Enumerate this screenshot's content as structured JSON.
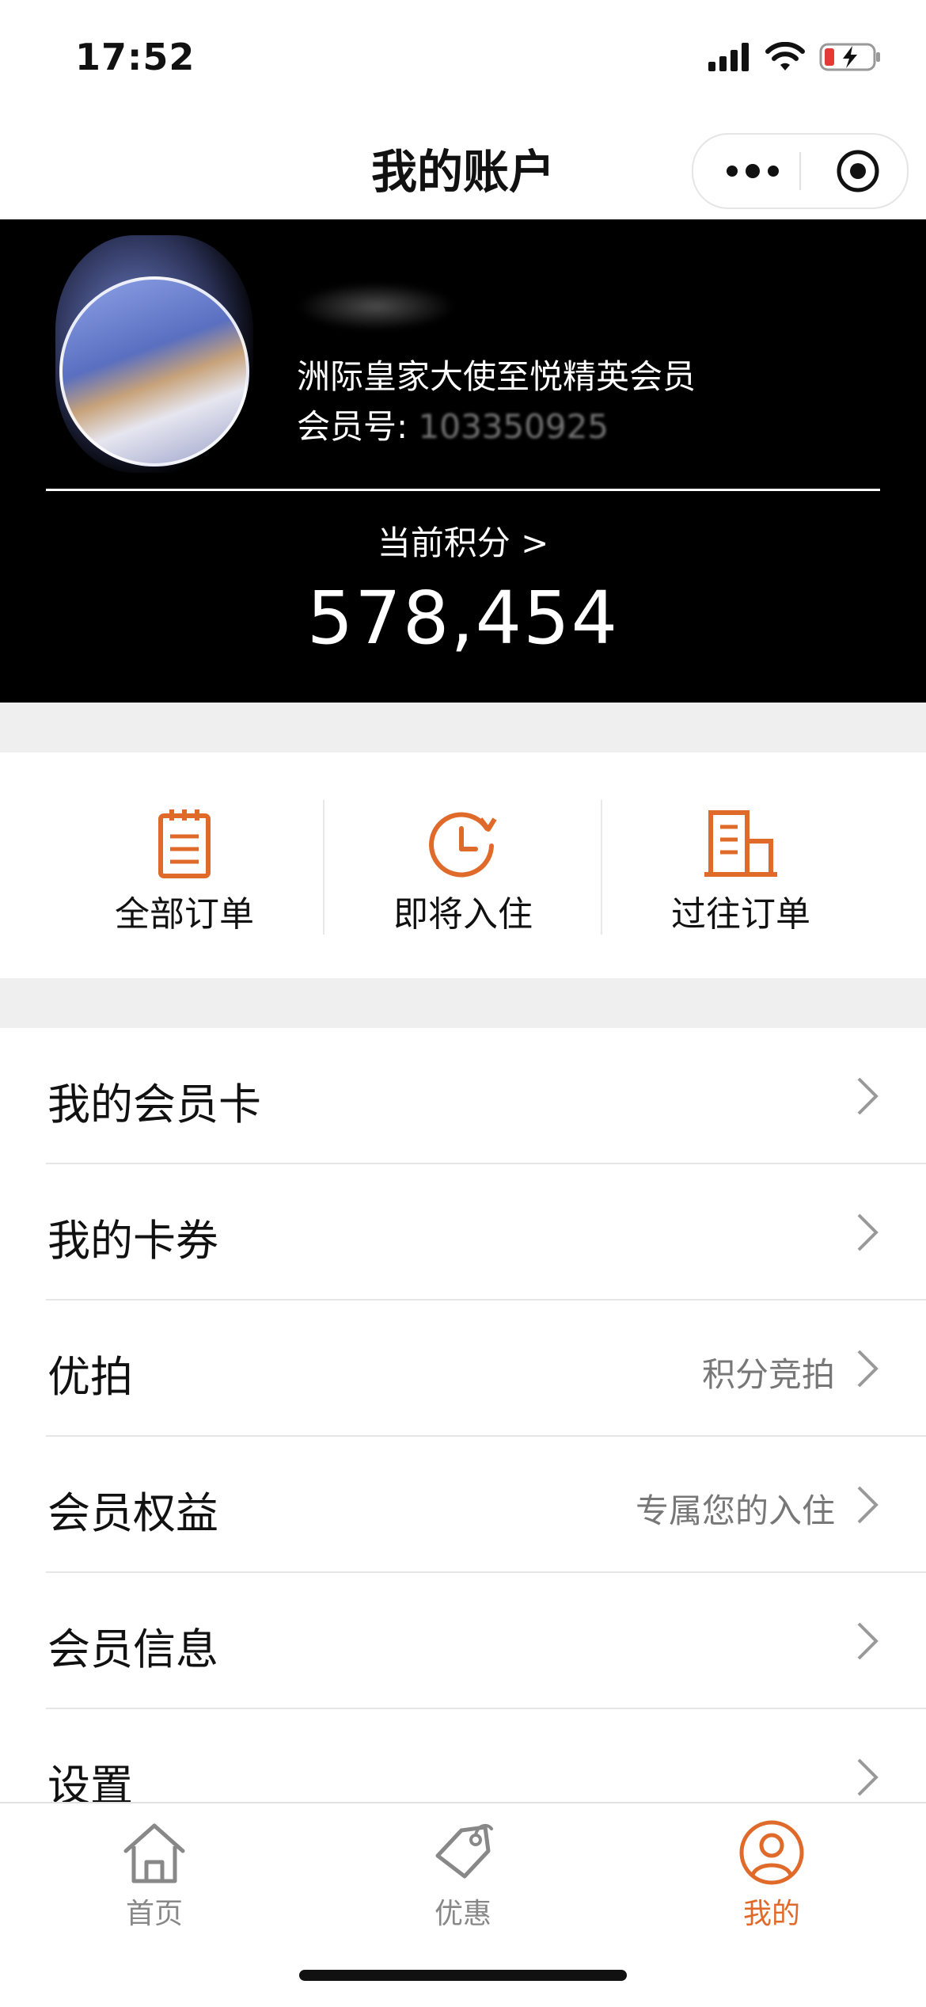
{
  "status_bar": {
    "time": "17:52"
  },
  "nav": {
    "title": "我的账户"
  },
  "member": {
    "tier": "洲际皇家大使至悦精英会员",
    "number_label": "会员号: ",
    "number": "103350925"
  },
  "points": {
    "label": "当前积分 >",
    "value": "578,454"
  },
  "orders": [
    {
      "label": "全部订单",
      "icon": "clipboard-icon"
    },
    {
      "label": "即将入住",
      "icon": "clock-icon"
    },
    {
      "label": "过往订单",
      "icon": "building-icon"
    }
  ],
  "menu": [
    {
      "label": "我的会员卡",
      "hint": ""
    },
    {
      "label": "我的卡券",
      "hint": ""
    },
    {
      "label": "优拍",
      "hint": "积分竞拍"
    },
    {
      "label": "会员权益",
      "hint": "专属您的入住"
    },
    {
      "label": "会员信息",
      "hint": ""
    },
    {
      "label": "设置",
      "hint": ""
    }
  ],
  "tabs": [
    {
      "label": "首页",
      "icon": "home-icon",
      "active": false
    },
    {
      "label": "优惠",
      "icon": "tag-icon",
      "active": false
    },
    {
      "label": "我的",
      "icon": "user-icon",
      "active": true
    }
  ],
  "colors": {
    "accent": "#e06a2a",
    "card_bg": "#000000",
    "separator": "#efefef"
  }
}
